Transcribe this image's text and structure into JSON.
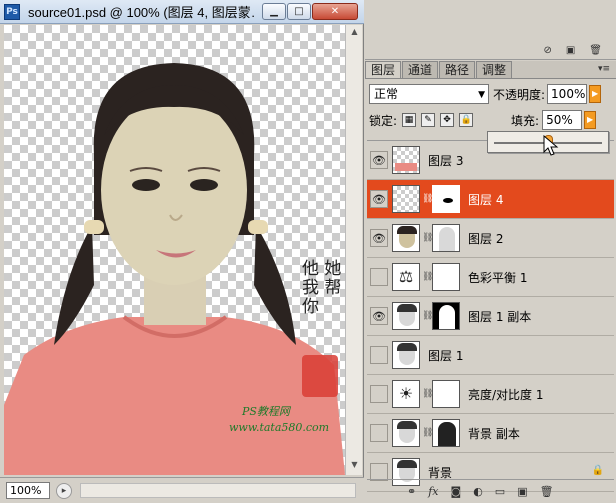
{
  "document": {
    "title": "source01.psd @ 100% (图层 4, 图层蒙…",
    "app_icon": "Ps",
    "zoom": "100%",
    "canvas_text": [
      "他",
      "她",
      "我",
      "帮",
      "你",
      "PS教程网",
      "www.tata580.com"
    ]
  },
  "window_buttons": {
    "minimize": "▁",
    "maximize": "□",
    "close": "✕"
  },
  "layers_panel": {
    "tabs": [
      {
        "label": "图层",
        "active": true
      },
      {
        "label": "通道",
        "active": false
      },
      {
        "label": "路径",
        "active": false
      },
      {
        "label": "调整",
        "active": false
      }
    ],
    "blend_mode": "正常",
    "opacity_label": "不透明度:",
    "opacity_value": "100%",
    "lock_label": "锁定:",
    "fill_label": "填充:",
    "fill_value": "50%",
    "fill_slider_fraction": 0.5,
    "layers": [
      {
        "name": "图层 3",
        "visible": true,
        "selected": false,
        "thumb": "checker-pink",
        "has_mask": false
      },
      {
        "name": "图层 4",
        "visible": true,
        "selected": true,
        "thumb": "checker",
        "has_mask": true,
        "mask": "black-oval"
      },
      {
        "name": "图层 2",
        "visible": true,
        "selected": false,
        "thumb": "girl",
        "has_mask": true,
        "mask": "white-silhouette"
      },
      {
        "name": "色彩平衡 1",
        "visible": false,
        "selected": false,
        "thumb": "balance-icon",
        "has_mask": true,
        "mask": "white"
      },
      {
        "name": "图层 1 副本",
        "visible": true,
        "selected": false,
        "thumb": "girl-bw",
        "has_mask": true,
        "mask": "white-silhouette-dark"
      },
      {
        "name": "图层 1",
        "visible": false,
        "selected": false,
        "thumb": "girl-bw",
        "has_mask": false
      },
      {
        "name": "亮度/对比度 1",
        "visible": false,
        "selected": false,
        "thumb": "brightness-icon",
        "has_mask": true,
        "mask": "white"
      },
      {
        "name": "背景 副本",
        "visible": false,
        "selected": false,
        "thumb": "girl-bw",
        "has_mask": true,
        "mask": "dark-silhouette"
      },
      {
        "name": "背景",
        "visible": false,
        "selected": false,
        "thumb": "girl-bw",
        "has_mask": false,
        "locked": true
      }
    ],
    "footer_icons": [
      "link-icon",
      "fx-icon",
      "mask-icon",
      "adjustment-icon",
      "group-icon",
      "new-layer-icon",
      "trash-icon"
    ]
  },
  "colors": {
    "selected_layer": "#e34a1d",
    "accent_orange": "#f49b22"
  }
}
